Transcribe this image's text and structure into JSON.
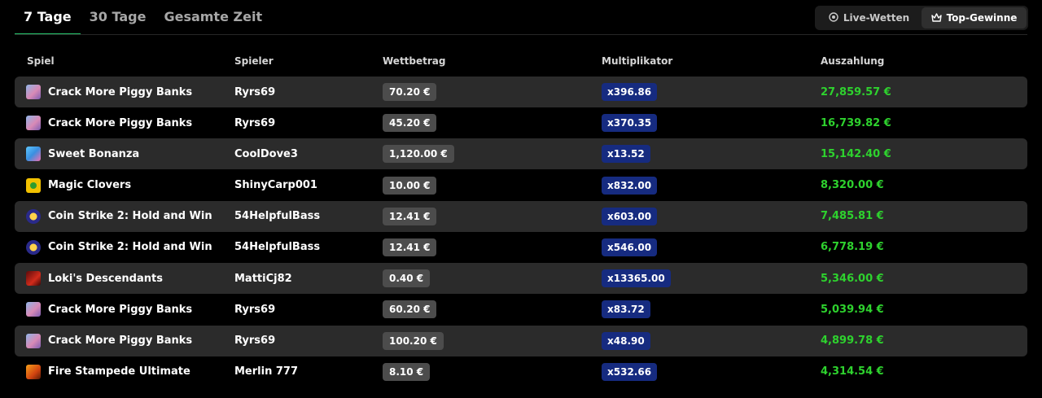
{
  "tabs": [
    {
      "label": "7 Tage",
      "active": true
    },
    {
      "label": "30 Tage",
      "active": false
    },
    {
      "label": "Gesamte Zeit",
      "active": false
    }
  ],
  "toggle": {
    "live": {
      "label": "Live-Wetten",
      "icon": "live-icon"
    },
    "top": {
      "label": "Top-Gewinne",
      "icon": "crown-icon"
    }
  },
  "columns": {
    "game": "Spiel",
    "player": "Spieler",
    "bet": "Wettbetrag",
    "multiplier": "Multiplikator",
    "payout": "Auszahlung"
  },
  "colors": {
    "accent_tab": "#27c46b",
    "payout": "#2ed22e",
    "bet_pill": "#4c4c4c",
    "mult_pill": "#162b80",
    "row_shade": "#2b2b2b"
  },
  "rows": [
    {
      "game": "Crack More Piggy Banks",
      "icon": "piggy",
      "player": "Ryrs69",
      "bet": "70.20 €",
      "multiplier": "x396.86",
      "payout": "27,859.57 €"
    },
    {
      "game": "Crack More Piggy Banks",
      "icon": "piggy",
      "player": "Ryrs69",
      "bet": "45.20 €",
      "multiplier": "x370.35",
      "payout": "16,739.82 €"
    },
    {
      "game": "Sweet Bonanza",
      "icon": "sweet",
      "player": "CoolDove3",
      "bet": "1,120.00 €",
      "multiplier": "x13.52",
      "payout": "15,142.40 €"
    },
    {
      "game": "Magic Clovers",
      "icon": "clover",
      "player": "ShinyCarp001",
      "bet": "10.00 €",
      "multiplier": "x832.00",
      "payout": "8,320.00 €"
    },
    {
      "game": "Coin Strike 2: Hold and Win",
      "icon": "coin",
      "player": "54HelpfulBass",
      "bet": "12.41 €",
      "multiplier": "x603.00",
      "payout": "7,485.81 €"
    },
    {
      "game": "Coin Strike 2: Hold and Win",
      "icon": "coin",
      "player": "54HelpfulBass",
      "bet": "12.41 €",
      "multiplier": "x546.00",
      "payout": "6,778.19 €"
    },
    {
      "game": "Loki's Descendants",
      "icon": "loki",
      "player": "MattiCj82",
      "bet": "0.40 €",
      "multiplier": "x13365.00",
      "payout": "5,346.00 €"
    },
    {
      "game": "Crack More Piggy Banks",
      "icon": "piggy",
      "player": "Ryrs69",
      "bet": "60.20 €",
      "multiplier": "x83.72",
      "payout": "5,039.94 €"
    },
    {
      "game": "Crack More Piggy Banks",
      "icon": "piggy",
      "player": "Ryrs69",
      "bet": "100.20 €",
      "multiplier": "x48.90",
      "payout": "4,899.78 €"
    },
    {
      "game": "Fire Stampede Ultimate",
      "icon": "fire",
      "player": "Merlin 777",
      "bet": "8.10 €",
      "multiplier": "x532.66",
      "payout": "4,314.54 €"
    }
  ]
}
